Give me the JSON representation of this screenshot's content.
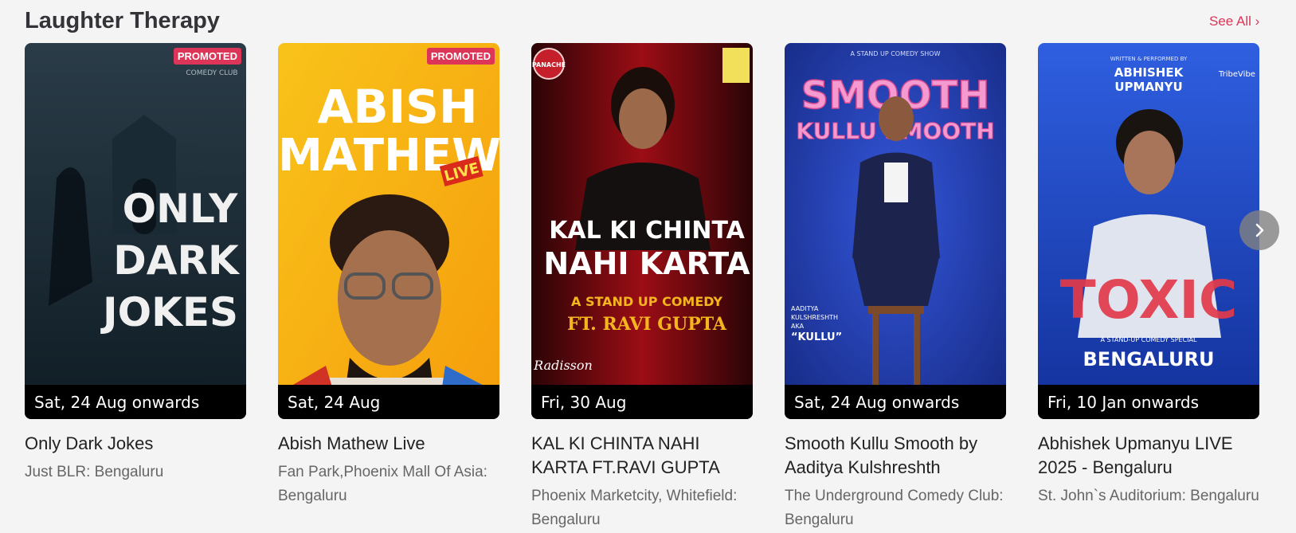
{
  "section": {
    "title": "Laughter Therapy",
    "see_all": "See All ›"
  },
  "badge_label": "PROMOTED",
  "cards": [
    {
      "title": "Only Dark Jokes",
      "venue": "Just BLR: Bengaluru",
      "date": "Sat, 24 Aug onwards",
      "promoted": true,
      "poster": {
        "lines": [
          "ONLY",
          "DARK",
          "JOKES"
        ],
        "top_text": "COMEDY CLUB",
        "colors": [
          "#0f1c24",
          "#2a3c48"
        ]
      }
    },
    {
      "title": "Abish Mathew Live",
      "venue": "Fan Park,Phoenix Mall Of Asia: Bengaluru",
      "date": "Sat, 24 Aug",
      "promoted": true,
      "poster": {
        "lines": [
          "ABISH",
          "MATHEW"
        ],
        "tag": "LIVE",
        "colors": [
          "#f9c31a",
          "#f59d0c"
        ]
      }
    },
    {
      "title": "KAL KI CHINTA NAHI KARTA FT.RAVI GUPTA",
      "venue": "Phoenix Marketcity, Whitefield: Bengaluru",
      "date": "Fri, 30 Aug",
      "promoted": false,
      "poster": {
        "lines": [
          "KAL KI CHINTA",
          "NAHI KARTA"
        ],
        "sub": "A STAND UP COMEDY",
        "sub2": "FT. RAVI GUPTA",
        "logo": "PANACHE",
        "footer": "Radisson",
        "colors": [
          "#2a0406",
          "#9c0d15"
        ]
      }
    },
    {
      "title": "Smooth Kullu Smooth by Aaditya Kulshreshth",
      "venue": "The Underground Comedy Club: Bengaluru",
      "date": "Sat, 24 Aug onwards",
      "promoted": false,
      "poster": {
        "top_text": "A STAND UP COMEDY SHOW",
        "lines": [
          "SMOOTH",
          "KULLU SMOOTH"
        ],
        "caption": [
          "AADITYA",
          "KULSHRESHTH",
          "AKA"
        ],
        "nickname": "“KULLU”",
        "colors": [
          "#1a2f8f",
          "#2c4ad0"
        ]
      }
    },
    {
      "title": "Abhishek Upmanyu LIVE 2025 - Bengaluru",
      "venue": "St. John`s Auditorium: Bengaluru",
      "date": "Fri, 10 Jan onwards",
      "promoted": false,
      "poster": {
        "top_text": "WRITTEN & PERFORMED BY",
        "lines": [
          "ABHISHEK",
          "UPMANYU"
        ],
        "big": "TOXIC",
        "sub": "A STAND-UP COMEDY SPECIAL",
        "city": "BENGALURU",
        "logo": "TribeVibe",
        "colors": [
          "#12309a",
          "#2f5fe0"
        ]
      }
    }
  ],
  "icons": {
    "next": "chevron-right-icon"
  },
  "colors": {
    "accent": "#dc3558",
    "title": "#333338",
    "venue": "#666666"
  }
}
